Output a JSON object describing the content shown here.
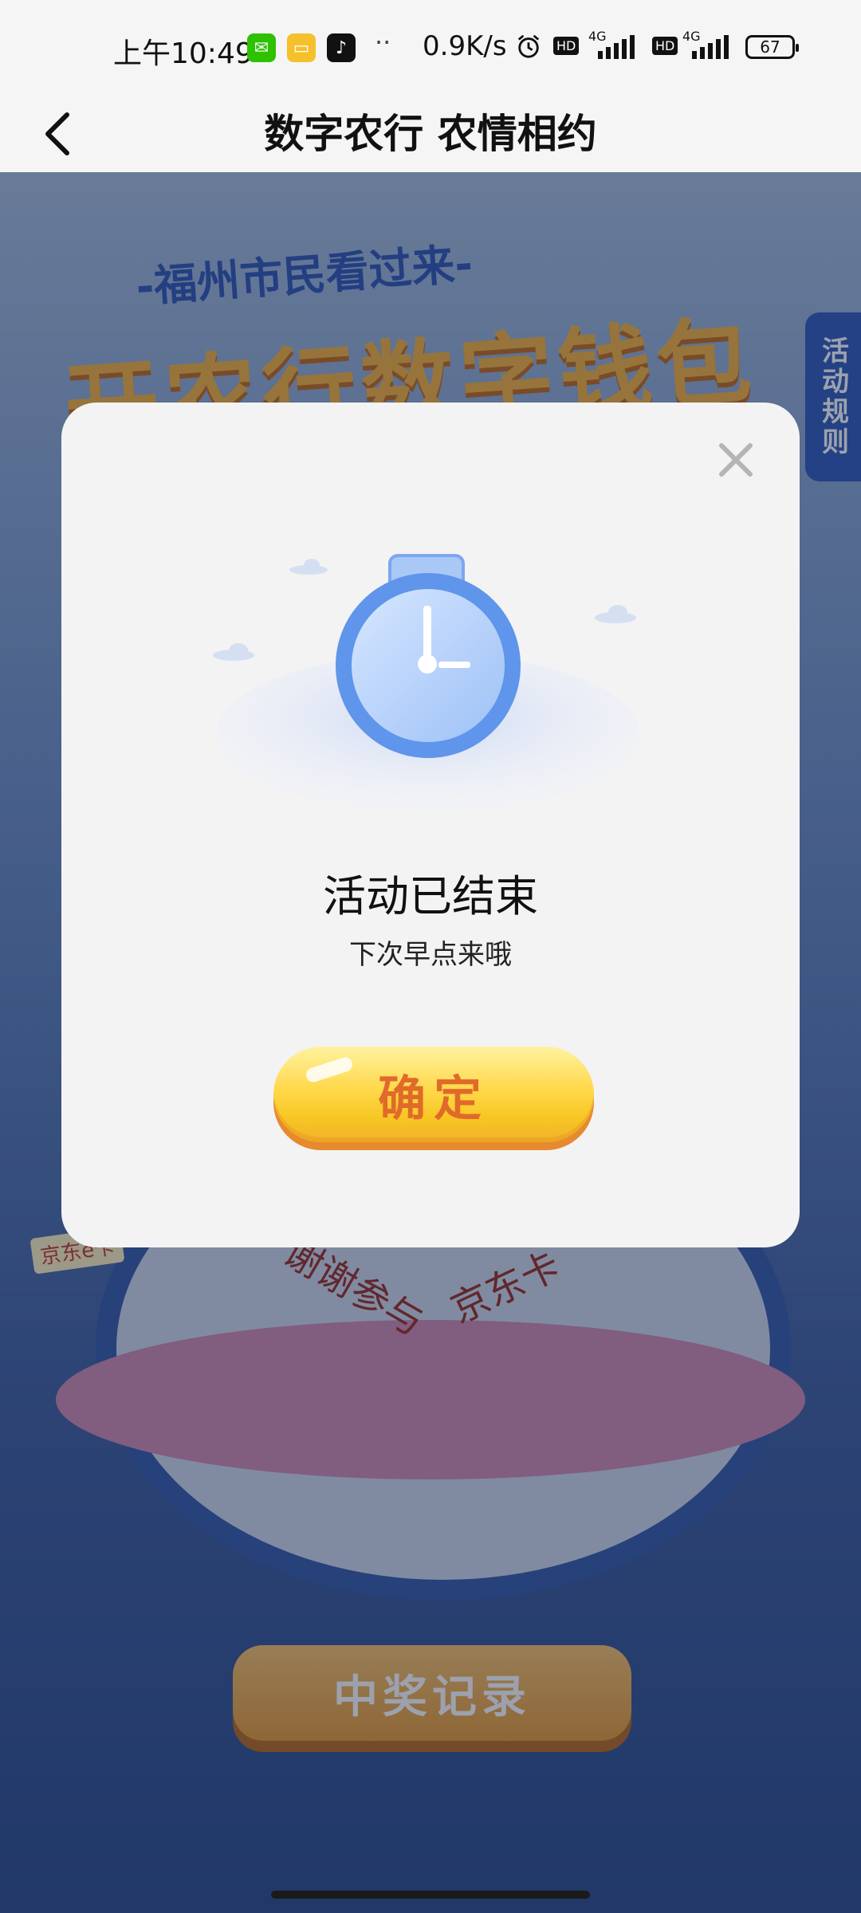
{
  "status_bar": {
    "time": "上午10:49",
    "network_speed": "0.9K/s",
    "battery": "67",
    "signal_labels": [
      "HD",
      "4G",
      "HD",
      "4G"
    ],
    "dots": "··"
  },
  "header": {
    "title": "数字农行 农情相约"
  },
  "background": {
    "slogan": "-福州市民看过来-",
    "hero": "开农行数字钱包",
    "rules_tab": "活动规则",
    "prize_badge": "京东e卡",
    "wheel_text_left": "谢谢参与",
    "wheel_text_right": "京东卡",
    "record_button": "中奖记录"
  },
  "modal": {
    "message": "活动已结束",
    "submessage": "下次早点来哦",
    "confirm_label": "确定"
  },
  "colors": {
    "accent_blue": "#3f7be0",
    "confirm_text": "#e06a2a",
    "confirm_yellow": "#ffd84a"
  }
}
